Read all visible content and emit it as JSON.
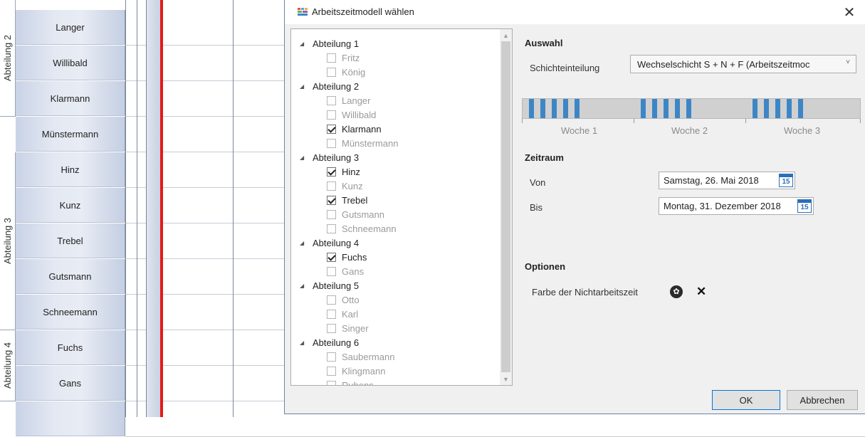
{
  "background": {
    "departments": [
      {
        "label": "Abteilung 2"
      },
      {
        "label": "Abteilung 3"
      },
      {
        "label": "Abteilung 4"
      }
    ],
    "rows": [
      "Langer",
      "Willibald",
      "Klarmann",
      "Münstermann",
      "Hinz",
      "Kunz",
      "Trebel",
      "Gutsmann",
      "Schneemann",
      "Fuchs",
      "Gans",
      ""
    ],
    "today_line_color": "#e31b1b"
  },
  "dialog": {
    "title": "Arbeitszeitmodell wählen",
    "close_icon": "close-icon",
    "tree": [
      {
        "label": "Abteilung 1",
        "members": [
          {
            "name": "Fritz",
            "checked": false
          },
          {
            "name": "König",
            "checked": false
          }
        ]
      },
      {
        "label": "Abteilung 2",
        "members": [
          {
            "name": "Langer",
            "checked": false
          },
          {
            "name": "Willibald",
            "checked": false
          },
          {
            "name": "Klarmann",
            "checked": true
          },
          {
            "name": "Münstermann",
            "checked": false
          }
        ]
      },
      {
        "label": "Abteilung 3",
        "members": [
          {
            "name": "Hinz",
            "checked": true
          },
          {
            "name": "Kunz",
            "checked": false
          },
          {
            "name": "Trebel",
            "checked": true
          },
          {
            "name": "Gutsmann",
            "checked": false
          },
          {
            "name": "Schneemann",
            "checked": false
          }
        ]
      },
      {
        "label": "Abteilung 4",
        "members": [
          {
            "name": "Fuchs",
            "checked": true
          },
          {
            "name": "Gans",
            "checked": false
          }
        ]
      },
      {
        "label": "Abteilung 5",
        "members": [
          {
            "name": "Otto",
            "checked": false
          },
          {
            "name": "Karl",
            "checked": false
          },
          {
            "name": "Singer",
            "checked": false
          }
        ]
      },
      {
        "label": "Abteilung 6",
        "members": [
          {
            "name": "Saubermann",
            "checked": false
          },
          {
            "name": "Klingmann",
            "checked": false
          },
          {
            "name": "Rubens",
            "checked": false
          }
        ]
      }
    ],
    "auswahl": {
      "title": "Auswahl",
      "schicht_label": "Schichteinteilung",
      "schicht_value": "Wechselschicht  S + N + F (Arbeitszeitmoc",
      "weeks": [
        "Woche 1",
        "Woche 2",
        "Woche 3"
      ],
      "shift_color": "#3d86c6"
    },
    "zeitraum": {
      "title": "Zeitraum",
      "von_label": "Von",
      "von_value": "Samstag, 26. Mai 2018",
      "bis_label": "Bis",
      "bis_value": "Montag, 31. Dezember 2018",
      "calendar_icon_day": "15"
    },
    "optionen": {
      "title": "Optionen",
      "farbe_label": "Farbe der Nichtarbeitszeit",
      "clear_symbol": "✕"
    },
    "buttons": {
      "ok": "OK",
      "cancel": "Abbrechen"
    }
  }
}
